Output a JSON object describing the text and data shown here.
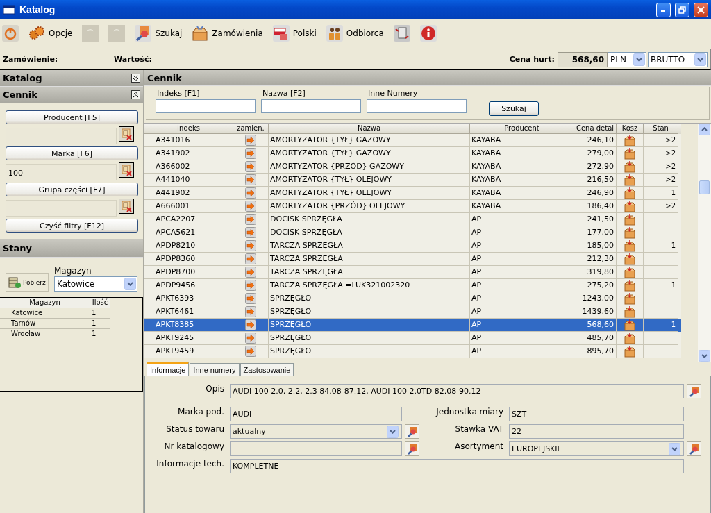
{
  "window": {
    "title": "Katalog"
  },
  "toolbar": [
    {
      "kind": "power",
      "disabled": false
    },
    {
      "kind": "gears",
      "label": "Opcje",
      "disabled": false
    },
    {
      "kind": "back",
      "disabled": true
    },
    {
      "kind": "forward",
      "disabled": true
    },
    {
      "kind": "search",
      "label": "Szukaj",
      "disabled": false
    },
    {
      "kind": "box",
      "label": "Zamówienia",
      "disabled": false
    },
    {
      "kind": "flag",
      "label": "Polski",
      "disabled": false
    },
    {
      "kind": "people",
      "label": "Odbiorca",
      "disabled": false
    },
    {
      "kind": "document",
      "disabled": false
    },
    {
      "kind": "info",
      "disabled": false
    }
  ],
  "order_bar": {
    "order_label": "Zamówienie:",
    "value_label": "Wartość:",
    "price_label": "Cena hurt:",
    "price": "568,60",
    "currency": "PLN",
    "price_type": "BRUTTO"
  },
  "sidebar": {
    "katalog": {
      "title": "Katalog",
      "expanded": false
    },
    "cennik": {
      "title": "Cennik",
      "expanded": true,
      "filters": [
        {
          "button": "Producent [F5]"
        },
        {
          "button": "Marka [F6]",
          "value": "100"
        },
        {
          "button": "Grupa części [F7]"
        }
      ],
      "clear_button": "Czyść filtry [F12]"
    },
    "stany": {
      "title": "Stany",
      "fetch_button": "Pobierz",
      "warehouse_label": "Magazyn",
      "warehouse": "Katowice",
      "columns": [
        "Magazyn",
        "Ilość"
      ],
      "rows": [
        [
          "Katowice",
          "1"
        ],
        [
          "Tarnów",
          "1"
        ],
        [
          "Wrocław",
          "1"
        ]
      ]
    }
  },
  "main": {
    "title": "Cennik",
    "search_fields": [
      {
        "label": "Indeks [F1]"
      },
      {
        "label": "Nazwa [F2]"
      },
      {
        "label": "Inne Numery"
      }
    ],
    "search_button": "Szukaj",
    "columns": [
      "Indeks",
      "zamien.",
      "Nazwa",
      "Producent",
      "Cena detal",
      "Kosz",
      "Stan"
    ],
    "rows": [
      {
        "indeks": "A341016",
        "nazwa": "AMORTYZATOR {TYŁ} GAZOWY",
        "producent": "KAYABA",
        "cena": "246,10",
        "stan": ">2",
        "selected": false
      },
      {
        "indeks": "A341902",
        "nazwa": "AMORTYZATOR {TYŁ} GAZOWY",
        "producent": "KAYABA",
        "cena": "279,00",
        "stan": ">2",
        "selected": false
      },
      {
        "indeks": "A366002",
        "nazwa": "AMORTYZATOR {PRZÓD} GAZOWY",
        "producent": "KAYABA",
        "cena": "272,90",
        "stan": ">2",
        "selected": false
      },
      {
        "indeks": "A441040",
        "nazwa": "AMORTYZATOR {TYŁ} OLEJOWY",
        "producent": "KAYABA",
        "cena": "216,50",
        "stan": ">2",
        "selected": false
      },
      {
        "indeks": "A441902",
        "nazwa": "AMORTYZATOR {TYŁ} OLEJOWY",
        "producent": "KAYABA",
        "cena": "246,90",
        "stan": "1",
        "selected": false
      },
      {
        "indeks": "A666001",
        "nazwa": "AMORTYZATOR {PRZÓD} OLEJOWY",
        "producent": "KAYABA",
        "cena": "186,40",
        "stan": ">2",
        "selected": false
      },
      {
        "indeks": "APCA2207",
        "nazwa": "DOCISK SPRZĘGŁA",
        "producent": "AP",
        "cena": "241,50",
        "selected": false
      },
      {
        "indeks": "APCA5621",
        "nazwa": "DOCISK SPRZĘGŁA",
        "producent": "AP",
        "cena": "177,00",
        "selected": false
      },
      {
        "indeks": "APDP8210",
        "nazwa": "TARCZA SPRZĘGŁA",
        "producent": "AP",
        "cena": "185,00",
        "stan": "1",
        "selected": false
      },
      {
        "indeks": "APDP8360",
        "nazwa": "TARCZA SPRZĘGŁA",
        "producent": "AP",
        "cena": "212,30",
        "selected": false
      },
      {
        "indeks": "APDP8700",
        "nazwa": "TARCZA SPRZĘGŁA",
        "producent": "AP",
        "cena": "319,80",
        "selected": false
      },
      {
        "indeks": "APDP9456",
        "nazwa": "TARCZA SPRZĘGŁA =LUK321002320",
        "producent": "AP",
        "cena": "275,20",
        "stan": "1",
        "selected": false
      },
      {
        "indeks": "APKT6393",
        "nazwa": "SPRZĘGŁO",
        "producent": "AP",
        "cena": "1243,00",
        "selected": false
      },
      {
        "indeks": "APKT6461",
        "nazwa": "SPRZĘGŁO",
        "producent": "AP",
        "cena": "1439,60",
        "selected": false
      },
      {
        "indeks": "APKT8385",
        "nazwa": "SPRZĘGŁO",
        "producent": "AP",
        "cena": "568,60",
        "stan": "1",
        "selected": true
      },
      {
        "indeks": "APKT9245",
        "nazwa": "SPRZĘGŁO",
        "producent": "AP",
        "cena": "485,70",
        "selected": false
      },
      {
        "indeks": "APKT9459",
        "nazwa": "SPRZĘGŁO",
        "producent": "AP",
        "cena": "895,70",
        "selected": false
      }
    ],
    "tabs": [
      {
        "label": "Informacje",
        "selected": true
      },
      {
        "label": "Inne numery",
        "selected": false
      },
      {
        "label": "Zastosowanie",
        "selected": false
      }
    ],
    "details": {
      "description": {
        "label": "Opis",
        "value": "AUDI 100 2.0, 2.2, 2.3 84.08-87.12, AUDI 100 2.0TD 82.08-90.12",
        "lookup": true
      },
      "left": [
        {
          "label": "Marka pod.",
          "value": "AUDI",
          "kind": "text",
          "lookup": false
        },
        {
          "label": "Status towaru",
          "value": "aktualny",
          "kind": "select",
          "lookup": true
        },
        {
          "label": "Nr katalogowy",
          "kind": "text",
          "lookup": true
        }
      ],
      "right": [
        {
          "label": "Jednostka miary",
          "value": "SZT",
          "kind": "text",
          "lookup": false
        },
        {
          "label": "Stawka VAT",
          "value": "22",
          "kind": "text",
          "lookup": false
        },
        {
          "label": "Asortyment",
          "value": "EUROPEJSKIE",
          "kind": "select",
          "lookup": true
        }
      ],
      "tech": {
        "label": "Informacje tech.",
        "value": "KOMPLETNE"
      }
    }
  }
}
